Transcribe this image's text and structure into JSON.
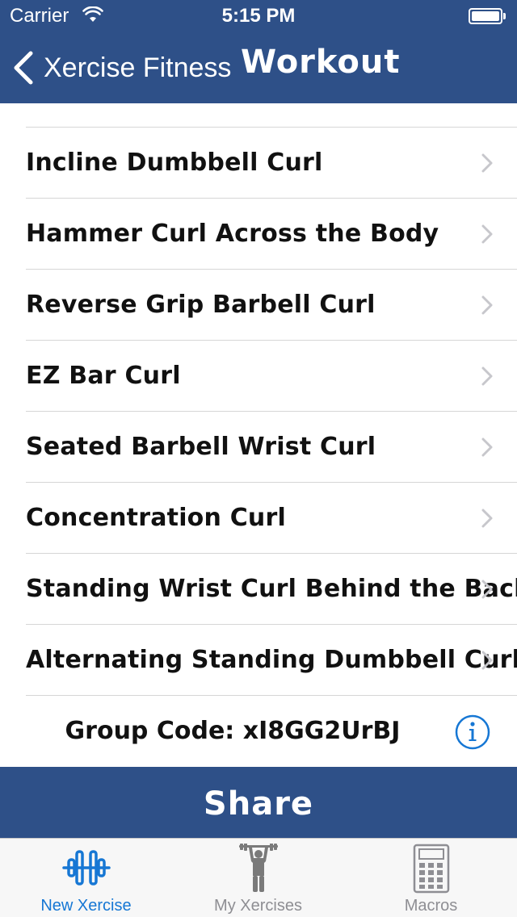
{
  "status_bar": {
    "carrier": "Carrier",
    "time": "5:15 PM"
  },
  "nav": {
    "back_label": "Xercise Fitness",
    "title": "Workout"
  },
  "exercises": [
    {
      "label": "Incline Dumbbell Curl"
    },
    {
      "label": "Hammer Curl Across the Body"
    },
    {
      "label": "Reverse Grip Barbell Curl"
    },
    {
      "label": "EZ Bar Curl"
    },
    {
      "label": "Seated Barbell Wrist Curl"
    },
    {
      "label": "Concentration Curl"
    },
    {
      "label": "Standing Wrist Curl Behind the Back"
    },
    {
      "label": "Alternating Standing Dumbbell Curl"
    }
  ],
  "group_code": "Group Code: xI8GG2UrBJ",
  "share_label": "Share",
  "tabs": [
    {
      "label": "New Xercise",
      "icon": "dumbbell-icon",
      "active": true
    },
    {
      "label": "My Xercises",
      "icon": "weightlifter-icon",
      "active": false
    },
    {
      "label": "Macros",
      "icon": "calculator-icon",
      "active": false
    }
  ],
  "colors": {
    "brand": "#2e5088",
    "tab_active": "#1677d4",
    "tab_inactive": "#8e8e93",
    "info": "#1677d4"
  }
}
